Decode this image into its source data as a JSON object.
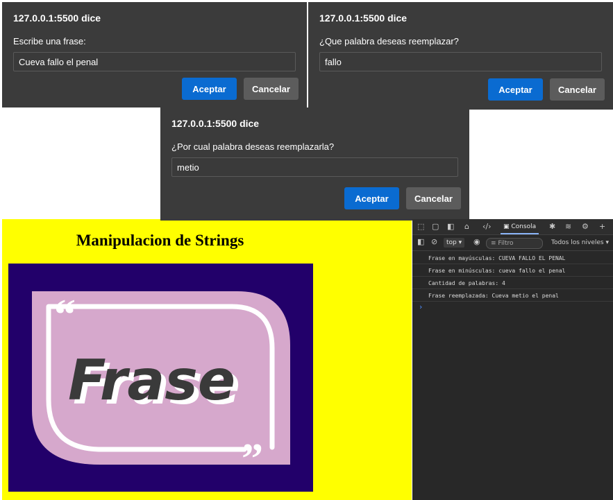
{
  "dialogs": [
    {
      "title": "127.0.0.1:5500 dice",
      "message": "Escribe una frase:",
      "input_value": "Cueva fallo el penal",
      "ok": "Aceptar",
      "cancel": "Cancelar"
    },
    {
      "title": "127.0.0.1:5500 dice",
      "message": "¿Que palabra deseas reemplazar?",
      "input_value": "fallo",
      "ok": "Aceptar",
      "cancel": "Cancelar"
    },
    {
      "title": "127.0.0.1:5500 dice",
      "message": "¿Por cual palabra deseas reemplazarla?",
      "input_value": "metio",
      "ok": "Aceptar",
      "cancel": "Cancelar"
    }
  ],
  "page": {
    "background": "#ffff00",
    "title": "Manipulacion de Strings",
    "banner": {
      "text": "Frase",
      "quote_open": "“",
      "quote_close": "”",
      "bg": "#22006a",
      "card": "#d6a8cc"
    }
  },
  "devtools": {
    "console_tab": "Consola",
    "context": "top",
    "filter_placeholder": "Filtro",
    "levels": "Todos los niveles",
    "messages": [
      "Frase en mayúsculas: CUEVA FALLO EL PENAL",
      "Frase en minúsculas: cueva fallo el penal",
      "Cantidad de palabras: 4",
      "Frase reemplazada: Cueva metio el penal"
    ],
    "prompt": "›"
  }
}
